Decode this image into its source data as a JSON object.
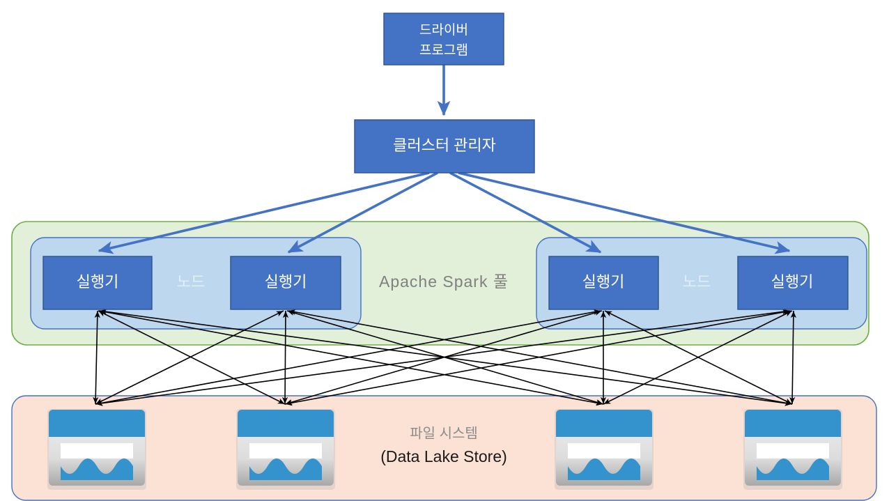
{
  "diagram": {
    "title": "Apache Spark architecture diagram",
    "colors": {
      "box_fill": "#4472c4",
      "box_stroke": "#2f528f",
      "node_fill": "#bdd7ee",
      "node_stroke": "#4472c4",
      "pool_fill": "#e2efd9",
      "pool_stroke": "#70ad47",
      "filesystem_fill": "#fbe2d5",
      "filesystem_stroke": "#4472c4",
      "arrow_blue": "#4472c4",
      "arrow_black": "#000000",
      "store_icon_blue": "#3493cd",
      "store_icon_gray": "#c9c9c9"
    },
    "driver": {
      "line1": "드라이버",
      "line2": "프로그램"
    },
    "cluster_manager": {
      "label": "클러스터 관리자"
    },
    "spark_pool": {
      "label": "Apache  Spark 풀"
    },
    "nodes": [
      {
        "label": "노드",
        "executors": [
          {
            "label": "실행기"
          },
          {
            "label": "실행기"
          }
        ]
      },
      {
        "label": "노드",
        "executors": [
          {
            "label": "실행기"
          },
          {
            "label": "실행기"
          }
        ]
      }
    ],
    "filesystem": {
      "label_top": "파일 시스템",
      "label_bottom": "(Data Lake Store)",
      "stores": [
        {
          "name": "data-lake-store-icon-1"
        },
        {
          "name": "data-lake-store-icon-2"
        },
        {
          "name": "data-lake-store-icon-3"
        },
        {
          "name": "data-lake-store-icon-4"
        }
      ]
    }
  }
}
